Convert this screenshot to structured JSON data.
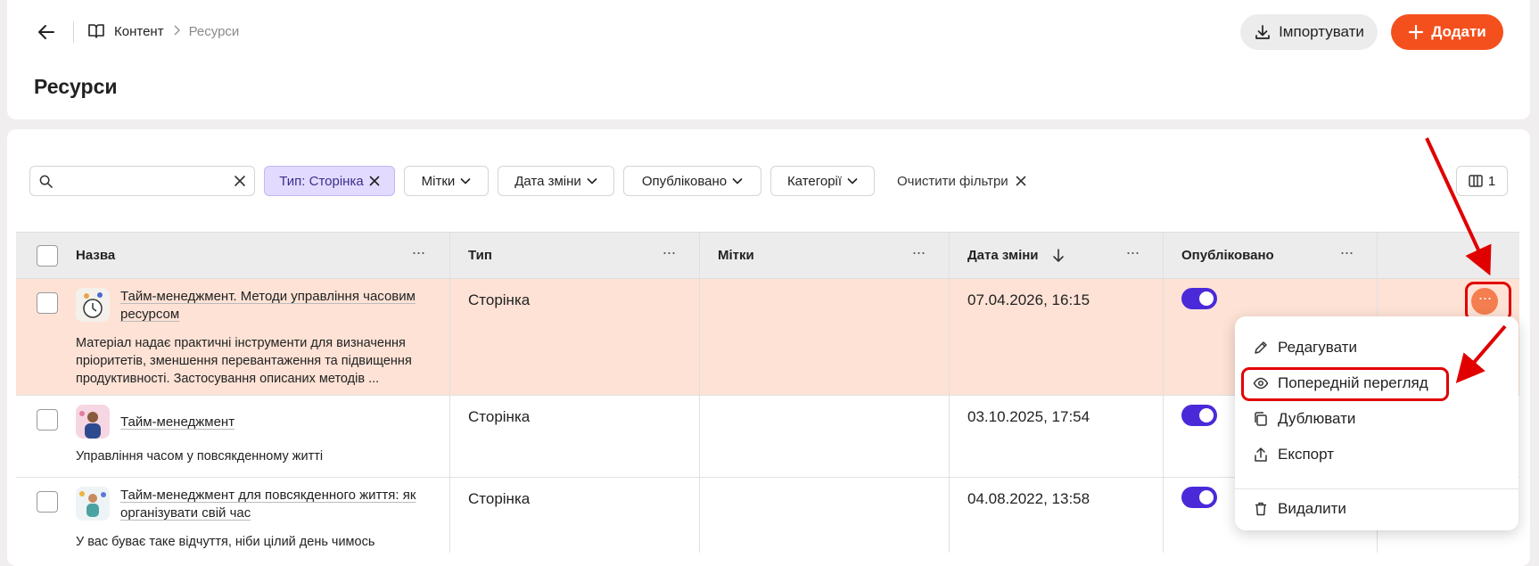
{
  "breadcrumb": {
    "section": "Контент",
    "current": "Ресурси"
  },
  "page": {
    "title": "Ресурси"
  },
  "actions": {
    "import_label": "Імпортувати",
    "add_label": "Додати"
  },
  "filters": {
    "search_value": "",
    "type_chip": "Тип: Сторінка",
    "tags": "Мітки",
    "date_changed": "Дата зміни",
    "published": "Опубліковано",
    "categories": "Категорії",
    "clear": "Очистити фільтри",
    "columns_count": "1"
  },
  "table": {
    "columns": [
      "Назва",
      "Тип",
      "Мітки",
      "Дата зміни",
      "Опубліковано"
    ],
    "rows": [
      {
        "title": "Тайм-менеджмент. Методи управління часовим ресурсом",
        "title_lines": [
          "Тайм-менеджмент. Методи управління часовим",
          "ресурсом"
        ],
        "description_lines": [
          "Матеріал надає практичні інструменти для визначення",
          "пріоритетів, зменшення перевантаження та підвищення",
          "продуктивності. Застосування описаних методів ..."
        ],
        "type": "Сторінка",
        "tags": "",
        "date": "07.04.2026, 16:15",
        "published": true
      },
      {
        "title": "Тайм-менеджмент",
        "title_lines": [
          "Тайм-менеджмент"
        ],
        "description_lines": [
          "Управління часом у повсякденному житті"
        ],
        "type": "Сторінка",
        "tags": "",
        "date": "03.10.2025, 17:54",
        "published": true
      },
      {
        "title": "Тайм-менеджмент для повсякденного життя: як організувати свій час",
        "title_lines": [
          "Тайм-менеджмент для повсякденного життя: як",
          "організувати свій час"
        ],
        "description_lines": [
          "У вас буває таке відчуття, ніби цілий день чимось"
        ],
        "type": "Сторінка",
        "tags": "",
        "date": "04.08.2022, 13:58",
        "published": true
      }
    ]
  },
  "context_menu": {
    "items": [
      "Редагувати",
      "Попередній перегляд",
      "Дублювати",
      "Експорт",
      "Видалити"
    ]
  },
  "colors": {
    "accent": "#f4501e",
    "toggle": "#4a2ad8",
    "row_highlight": "#fde2d5",
    "chip_active": "#e3dbff",
    "annotation": "#e00000"
  }
}
